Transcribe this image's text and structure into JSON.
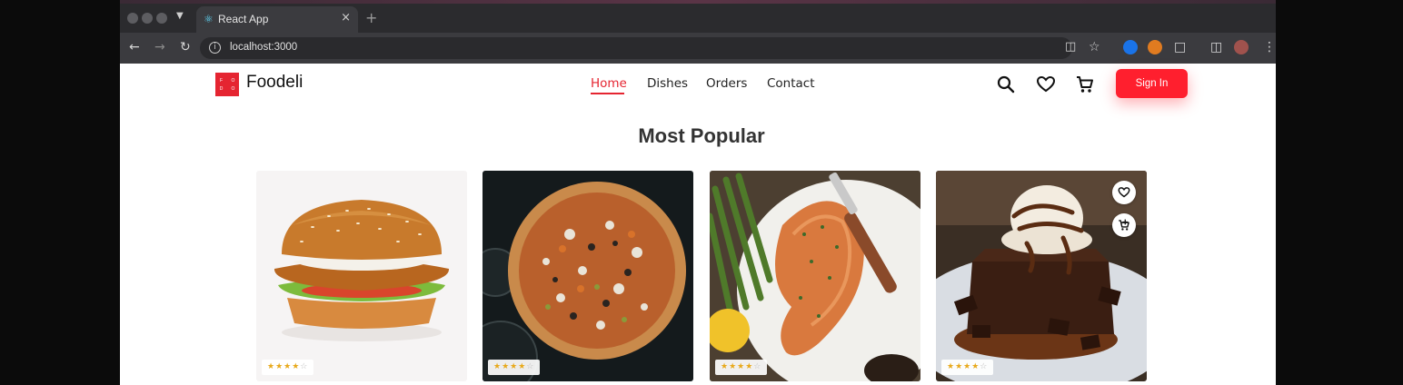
{
  "browser": {
    "tab_title": "React App",
    "url": "localhost:3000"
  },
  "header": {
    "logo_letters": [
      "F",
      "O",
      "D",
      "O"
    ],
    "brand": "Foodeli",
    "nav": [
      {
        "label": "Home",
        "active": true
      },
      {
        "label": "Dishes",
        "active": false
      },
      {
        "label": "Orders",
        "active": false
      },
      {
        "label": "Contact",
        "active": false
      }
    ],
    "sign_in_label": "Sign In"
  },
  "main": {
    "section_title": "Most Popular",
    "dishes": [
      {
        "image": "burger",
        "rating": 4,
        "max_rating": 5
      },
      {
        "image": "pizza",
        "rating": 4,
        "max_rating": 5
      },
      {
        "image": "salmon",
        "rating": 4,
        "max_rating": 5
      },
      {
        "image": "brownie",
        "rating": 4,
        "max_rating": 5
      }
    ]
  },
  "colors": {
    "accent": "#e52531",
    "sign_in": "#ff1f2e",
    "star": "#e8a91b"
  },
  "icons": [
    "search-icon",
    "heart-icon",
    "cart-icon",
    "add-to-cart-icon",
    "info-icon",
    "react-icon"
  ]
}
